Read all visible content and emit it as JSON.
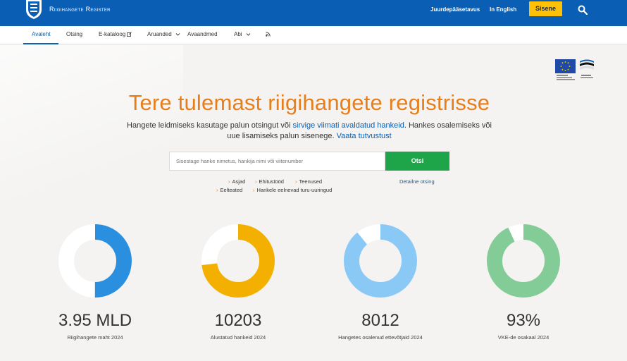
{
  "header": {
    "brand": "Riigihangete Register",
    "accessibility_label": "Juurdepääsetavus",
    "language_label": "In English",
    "login_label": "Sisene",
    "colors": {
      "bar": "#0a5eb4",
      "login": "#ffc107"
    }
  },
  "nav": {
    "items": [
      {
        "label": "Avaleht"
      },
      {
        "label": "Otsing"
      },
      {
        "label": "E-kataloog"
      },
      {
        "label": "Aruanded"
      },
      {
        "label": "Avaandmed"
      },
      {
        "label": "Abi"
      }
    ],
    "rss_icon": "rss-icon"
  },
  "hero": {
    "title": "Tere tulemast riigihangete registrisse",
    "text_1": "Hangete leidmiseks kasutage palun otsingut või ",
    "link_1": "sirvige viimati avaldatud hankeid",
    "text_2": ". Hankes osalemiseks või uue lisamiseks palun sisenege. ",
    "link_2": "Vaata tutvustust"
  },
  "search": {
    "placeholder": "Sisestage hanke nimetus, hankija nimi või viitenumber",
    "button_label": "Otsi",
    "quick_links": [
      "Asjad",
      "Ehitustööd",
      "Teenused",
      "Eelteated",
      "Hankele eelnevad turu-uuringud"
    ],
    "advanced_label": "Detailne otsing"
  },
  "stats": [
    {
      "value": "3.95 MLD",
      "label": "Riigihangete maht 2024",
      "fill": 0.5,
      "color": "#2b8fe0"
    },
    {
      "value": "10203",
      "label": "Alustatud hankeid 2024",
      "fill": 0.73,
      "color": "#f4b000"
    },
    {
      "value": "8012",
      "label": "Hangetes osalenud ettevõtjaid 2024",
      "fill": 0.89,
      "color": "#8ac8f5"
    },
    {
      "value": "93%",
      "label": "VKE-de osakaal 2024",
      "fill": 0.93,
      "color": "#84cc97"
    }
  ]
}
